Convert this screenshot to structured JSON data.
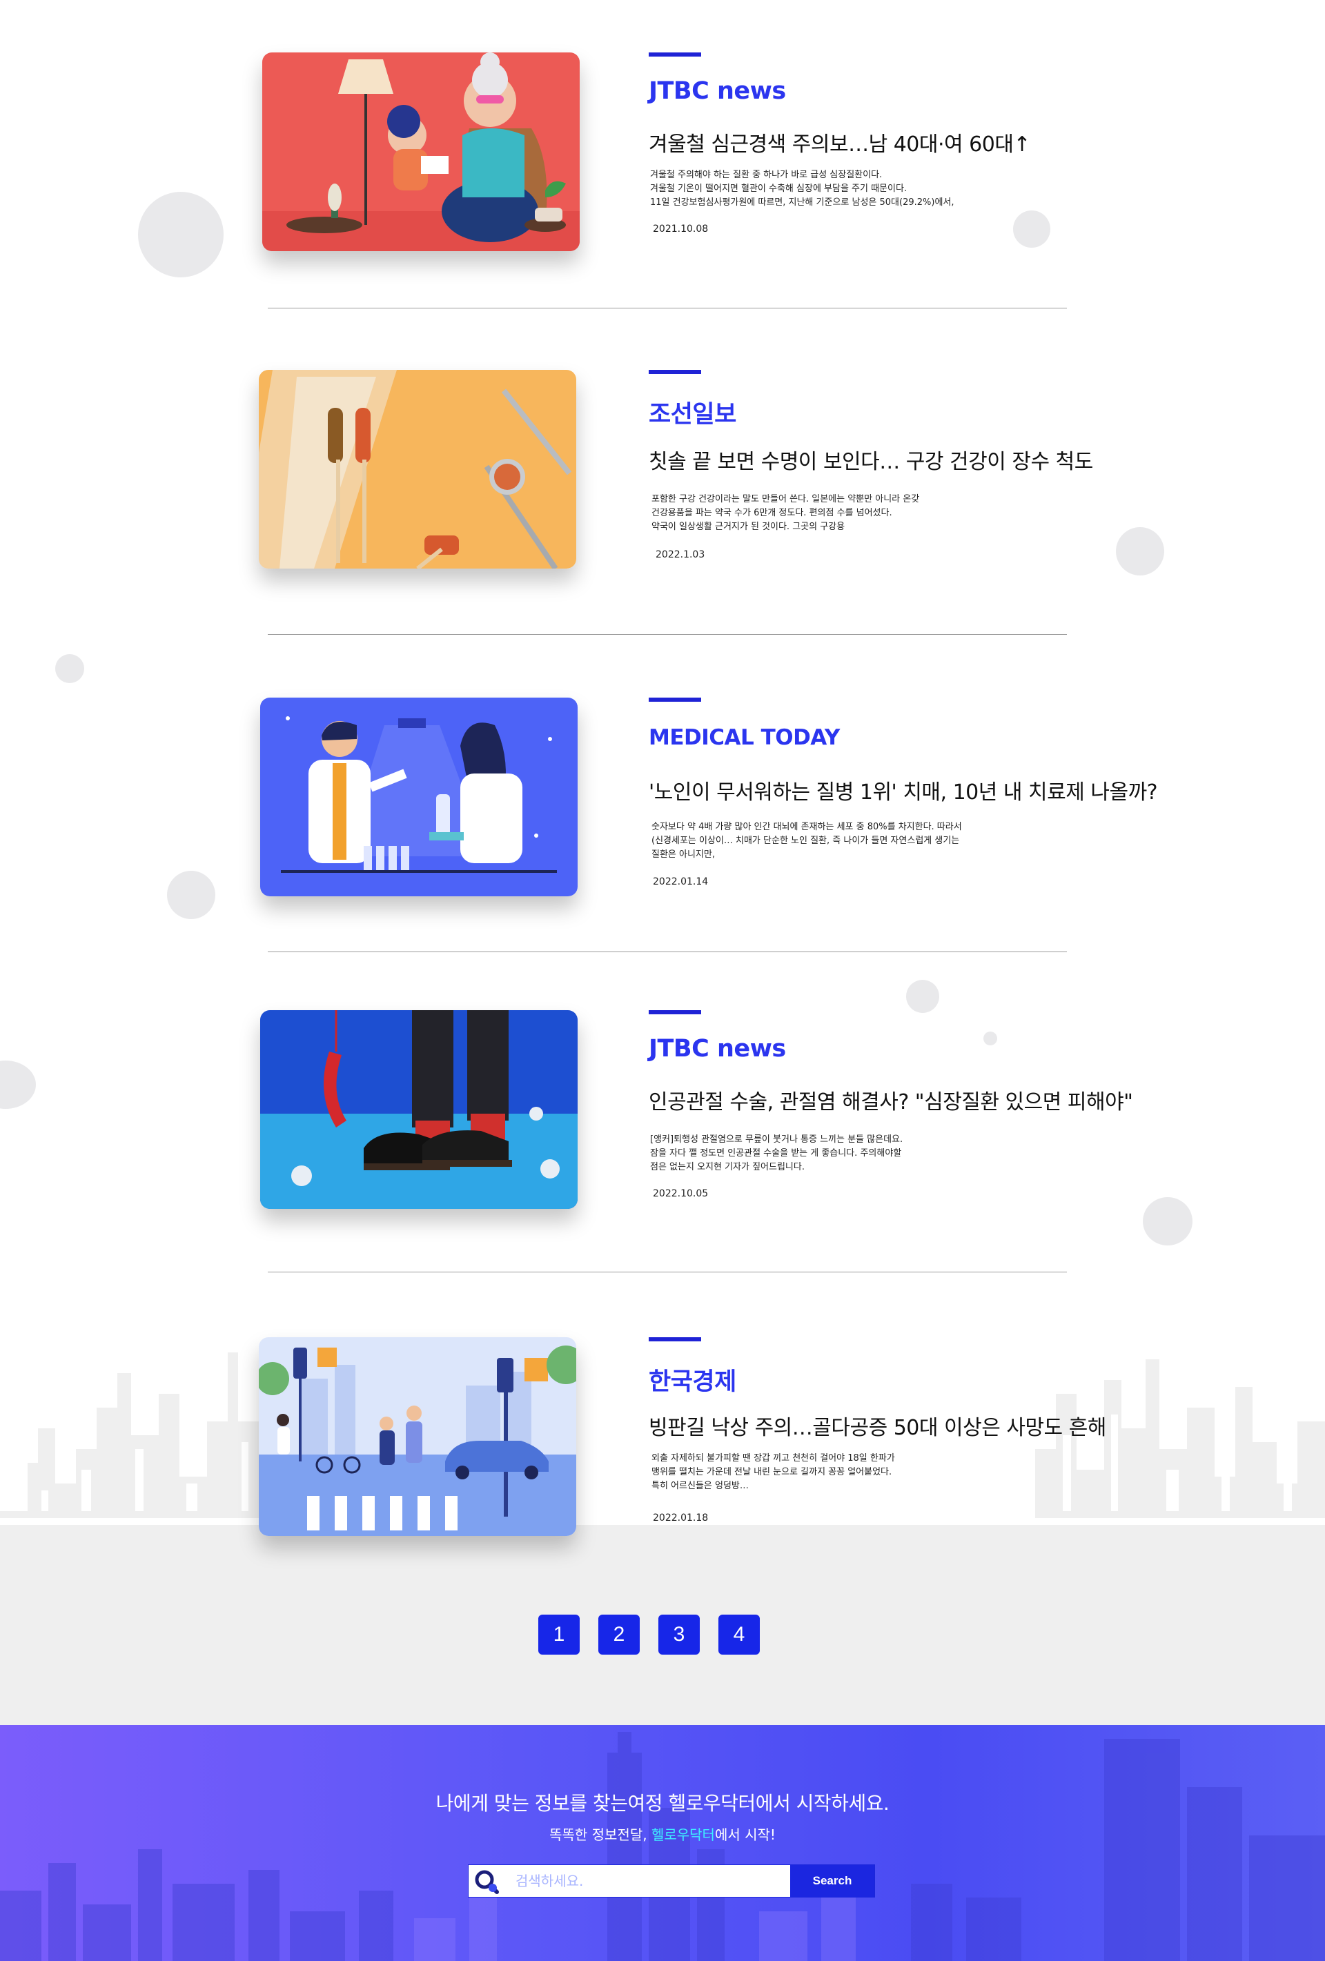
{
  "articles": [
    {
      "source": "JTBC news",
      "headline": "겨울철 심근경색 주의보…남 40대·여 60대↑",
      "excerpt": [
        "겨울철 주의해야 하는 질환 중 하나가 바로 급성 심장질환이다.",
        "겨울철 기온이 떨어지면 혈관이 수축해 심장에 부담을 주기 때문이다.",
        "11일 건강보험심사평가원에 따르면, 지난해 기준으로 남성은 50대(29.2%)에서,"
      ],
      "date": "2021.10.08",
      "image": "grandma-reading-illustration"
    },
    {
      "source": "조선일보",
      "headline": "칫솔 끝 보면 수명이 보인다… 구강 건강이 장수 척도",
      "excerpt": [
        "포함한 구강 건강이라는 말도 만들어 쓴다. 일본에는 약뿐만 아니라 온갖",
        " 건강용품을 파는 약국 수가 6만개 정도다. 편의점 수를 넘어섰다.",
        "약국이 일상생활 근거지가 된 것이다. 그곳의 구강용"
      ],
      "date": "2022.1.03",
      "image": "toothbrush-dental-mirror-photo"
    },
    {
      "source": "MEDICAL TODAY",
      "headline": " '노인이 무서워하는 질병 1위' 치매, 10년 내 치료제 나올까?",
      "excerpt": [
        "숫자보다 약 4배 가량 많아 인간 대뇌에 존재하는 세포 중 80%를 차지한다. 따라서",
        "(신경세포는 이상이… 치매가 단순한 노인 질환, 즉 나이가 들면 자연스럽게 생기는",
        "질환은 아니지만,"
      ],
      "date": "2022.01.14",
      "image": "scientists-laboratory-illustration"
    },
    {
      "source": "JTBC news",
      "headline": "인공관절 수술, 관절염 해결사? \"심장질환 있으면 피해야\"",
      "excerpt": [
        "[앵커]퇴행성 관절염으로 무릎이 붓거나 통증 느끼는 분들 많은데요.",
        "잠을 자다 깰 정도면 인공관절 수술을 받는 게 좋습니다. 주의해야할",
        "점은 없는지 오지현 기자가 짚어드립니다."
      ],
      "date": "2022.10.05",
      "image": "shoes-red-telephone-photo"
    },
    {
      "source": "한국경제",
      "headline": "빙판길 낙상 주의…골다공증 50대 이상은 사망도 흔해",
      "excerpt": [
        "외출 자제하되 불가피할 땐 장갑 끼고 천천히 걸어야 18일 한파가",
        " 맹위를 떨치는 가운데 전날 내린 눈으로 길까지 꽁꽁 얼어붙었다.",
        "특히 어르신들은 엉덩방…"
      ],
      "date": "2022.01.18",
      "image": "crosswalk-elderly-illustration"
    }
  ],
  "pagination": {
    "pages": [
      "1",
      "2",
      "3",
      "4"
    ]
  },
  "footer": {
    "title": "나에게 맞는 정보를 찾는여정 헬로우닥터에서 시작하세요.",
    "subtitle_before": "똑똑한 정보전달, ",
    "subtitle_highlight": "헬로우닥터",
    "subtitle_after": "에서 시작!",
    "search_placeholder": "검색하세요.",
    "search_button": "Search"
  },
  "colors": {
    "accent": "#2b35ef",
    "accent_bar": "#1f23d6",
    "page_button": "#1726e8",
    "highlight": "#3ef0ff"
  }
}
